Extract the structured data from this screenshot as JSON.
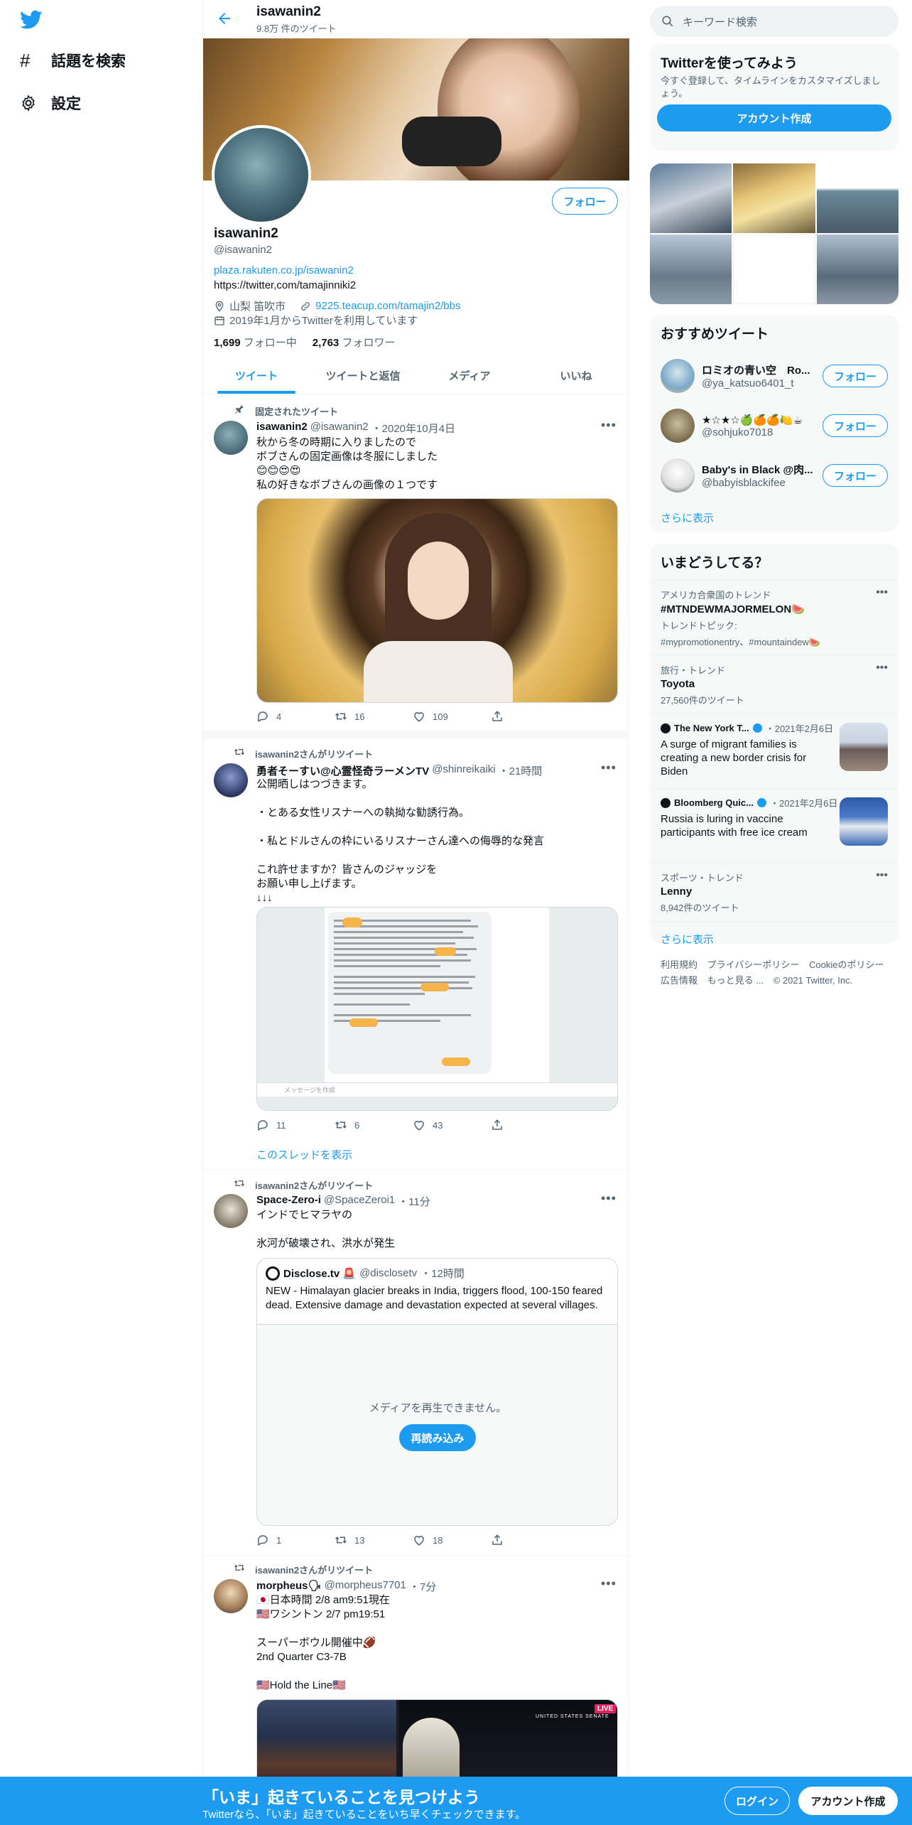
{
  "nav": {
    "explore_label": "話題を検索",
    "settings_label": "設定"
  },
  "header": {
    "name": "isawanin2",
    "tweet_count": "9.8万 件のツイート"
  },
  "profile": {
    "follow_button": "フォロー",
    "name": "isawanin2",
    "handle": "@isawanin2",
    "link1": "plaza.rakuten.co.jp/isawanin2",
    "link2": "https://twitter,com/tamajinniki2",
    "location": "山梨 笛吹市",
    "website": "9225.teacup.com/tamajin2/bbs",
    "joined": "2019年1月からTwitterを利用しています",
    "following_count": "1,699",
    "following_label": "フォロー中",
    "followers_count": "2,763",
    "followers_label": "フォロワー"
  },
  "tabs": [
    "ツイート",
    "ツイートと返信",
    "メディア",
    "いいね"
  ],
  "tweets": [
    {
      "context": "固定されたツイート",
      "name": "isawanin2",
      "handle": "@isawanin2",
      "time": "・2020年10月4日",
      "text": "秋から冬の時期に入りましたので\nボブさんの固定画像は冬服にしました\n😊😊😍😍\n私の好きなボブさんの画像の１つです",
      "reply": "4",
      "retweet": "16",
      "like": "109"
    },
    {
      "context": "isawanin2さんがリツイート",
      "name": "勇者そーすい@心霊怪奇ラーメンTV",
      "handle": "@shinreikaiki",
      "time": "・21時間",
      "text": "公開晒しはつづきます。\n\n・とある女性リスナーへの執拗な勧誘行為。\n\n・私とドルさんの枠にいるリスナーさん達への侮辱的な発言\n\nこれ許せますか？皆さんのジャッジを\nお願い申し上げます。\n↓↓↓",
      "media_input": "メッセージを作成",
      "reply": "11",
      "retweet": "6",
      "like": "43",
      "show_thread": "このスレッドを表示"
    },
    {
      "context": "isawanin2さんがリツイート",
      "name": "Space-Zero-i",
      "handle": "@SpaceZeroi1",
      "time": "・11分",
      "text": "インドでヒマラヤの\n\n氷河が破壊され、洪水が発生",
      "quote_name": "Disclose.tv 🚨",
      "quote_handle": "@disclosetv",
      "quote_time": "・12時間",
      "quote_text": "NEW - Himalayan glacier breaks in India, triggers flood, 100-150 feared dead. Extensive damage and devastation expected at several villages.",
      "media_error": "メディアを再生できません。",
      "reload": "再読み込み",
      "reply": "1",
      "retweet": "13",
      "like": "18"
    },
    {
      "context": "isawanin2さんがリツイート",
      "name": "morpheus🗣",
      "handle": "@morpheus7701",
      "time": "・7分",
      "text": "🇯🇵日本時間 2/8 am9:51現在\n🇺🇸ワシントン 2/7 pm19:51\n\nスーパーボウル開催中🏈\n2nd Quarter C3-7B\n\n🇺🇸Hold the Line🇺🇸",
      "live_badge": "LIVE",
      "senate_label": "UNITED STATES SENATE"
    }
  ],
  "right": {
    "search_placeholder": "キーワード検索",
    "signup_title": "Twitterを使ってみよう",
    "signup_desc": "今すぐ登録して、タイムラインをカスタマイズしましょう。",
    "signup_button": "アカウント作成",
    "rec_title": "おすすめツイート",
    "recs": [
      {
        "name": "ロミオの青い空　Ro...",
        "handle": "@ya_katsuo6401_t",
        "button": "フォロー"
      },
      {
        "name": "★☆★☆🍏🍊🍊🍋☕",
        "handle": "@sohjuko7018",
        "button": "フォロー"
      },
      {
        "name": "Baby's in Black @肉...",
        "handle": "@babyisblackifee",
        "button": "フォロー"
      }
    ],
    "show_more": "さらに表示",
    "trends_title": "いまどうしてる？",
    "trend1_cat": "アメリカ合衆国のトレンド",
    "trend1_title": "#MTNDEWMAJORMELON🍉",
    "trend1_topic": "トレンドトピック:",
    "trend1_tags": "#mypromotionentry、#mountaindew🍉",
    "trend2_cat": "旅行・トレンド",
    "trend2_title": "Toyota",
    "trend2_count": "27,560件のツイート",
    "news1_src": "The New York T...",
    "news1_time": "・2021年2月6日",
    "news1_text": "A surge of migrant families is creating a new border crisis for Biden",
    "news2_src": "Bloomberg Quic...",
    "news2_time": "・2021年2月6日",
    "news2_text": "Russia is luring in vaccine participants with free ice cream",
    "trend3_cat": "スポーツ・トレンド",
    "trend3_title": "Lenny",
    "trend3_count": "8,942件のツイート",
    "show_more2": "さらに表示"
  },
  "footer": {
    "terms": "利用規約",
    "privacy": "プライバシーポリシー",
    "cookie": "Cookieのポリシー",
    "ads": "広告情報",
    "more": "もっと見る ...",
    "copyright": "© 2021 Twitter, Inc."
  },
  "bottom_bar": {
    "title": "「いま」起きていることを見つけよう",
    "subtitle": "Twitterなら、「いま」起きていることをいち早くチェックできます。",
    "login": "ログイン",
    "signup": "アカウント作成"
  },
  "colors": {
    "accent": "#1d9bf0",
    "text": "#0f1419",
    "muted": "#536471"
  }
}
